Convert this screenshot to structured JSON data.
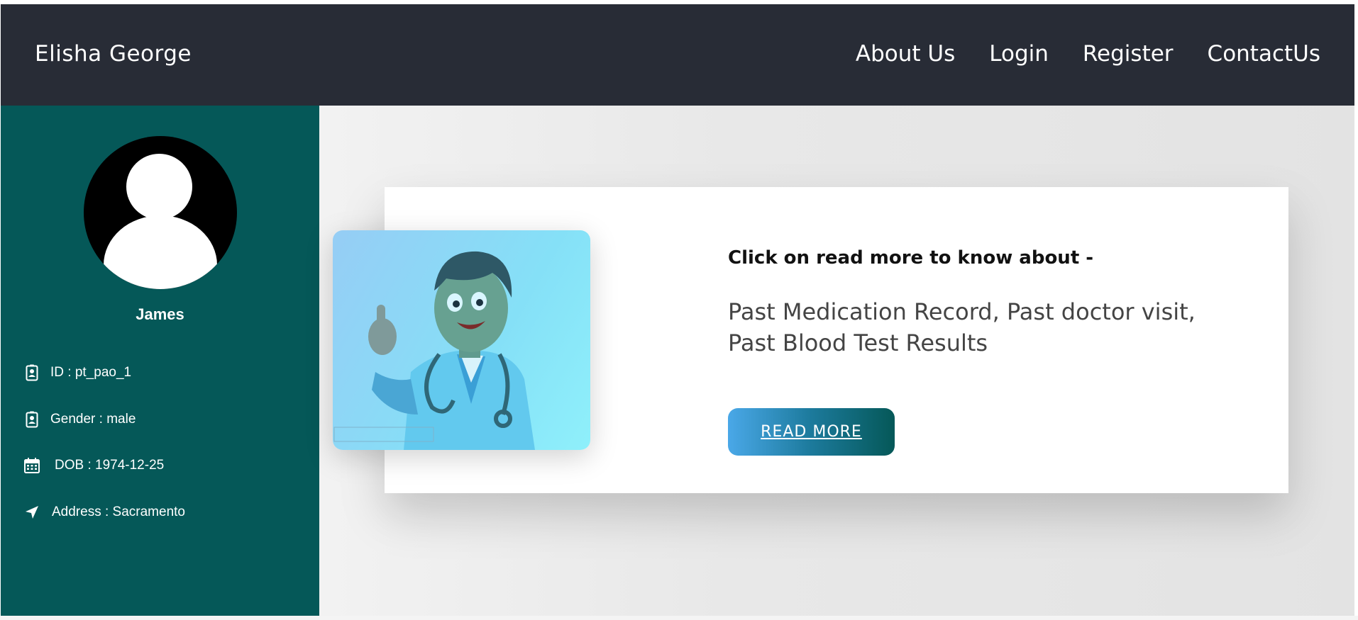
{
  "navbar": {
    "brand": "Elisha George",
    "links": [
      "About Us",
      "Login",
      "Register",
      "ContactUs"
    ]
  },
  "sidebar": {
    "avatar_icon": "user-avatar-icon",
    "name": "James",
    "info": [
      {
        "icon": "id-badge-icon",
        "text": "ID : pt_pao_1"
      },
      {
        "icon": "id-badge-icon",
        "text": "Gender : male"
      },
      {
        "icon": "calendar-icon",
        "text": "DOB : 1974-12-25"
      },
      {
        "icon": "location-arrow-icon",
        "text": "Address : Sacramento"
      }
    ]
  },
  "card": {
    "heading": "Click on read more to know about -",
    "body": "Past Medication Record, Past doctor visit, Past Blood Test Results",
    "button_label": "READ MORE",
    "illustration": "doctor-thumbs-up-illustration"
  },
  "colors": {
    "navbar_bg": "#282c36",
    "sidebar_bg": "#055858",
    "button_gradient_start": "#4aa8e8",
    "button_gradient_end": "#055858"
  }
}
